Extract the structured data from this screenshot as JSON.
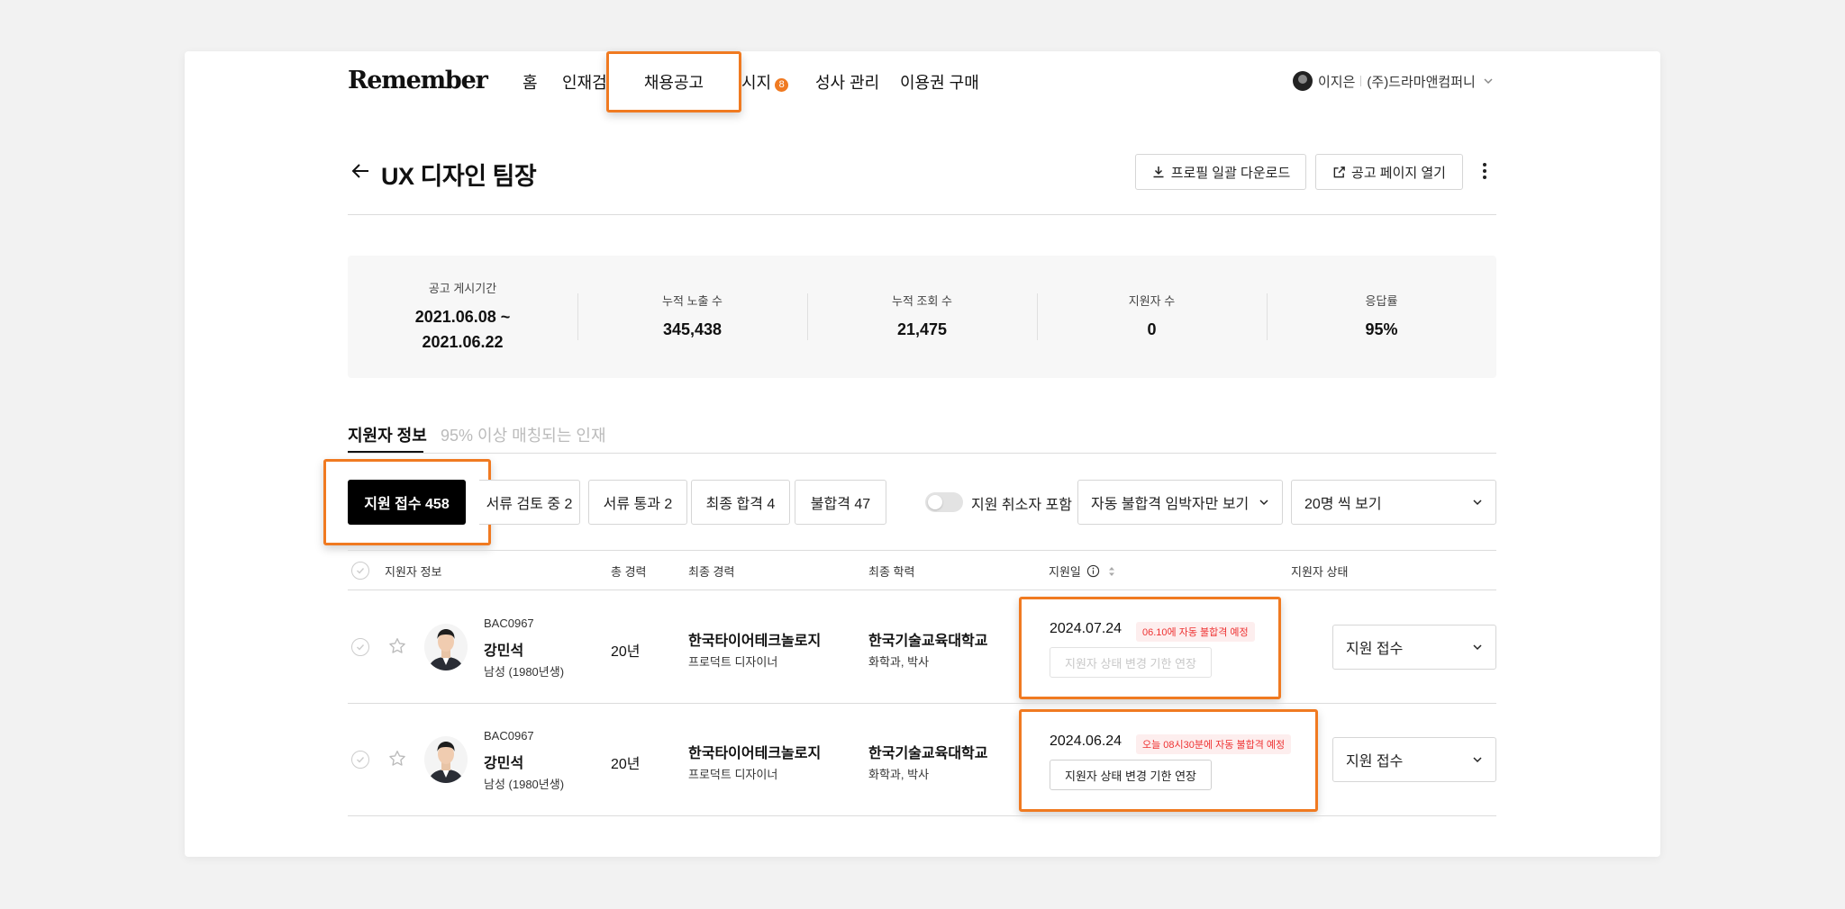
{
  "app": {
    "logo": "Remember"
  },
  "nav": {
    "items": [
      {
        "label": "홈"
      },
      {
        "label": "인재검"
      },
      {
        "label": "채용공고"
      },
      {
        "label": "시지"
      },
      {
        "label": "성사 관리"
      },
      {
        "label": "이용권 구매"
      }
    ],
    "message_badge": "8",
    "user_name": "이지은",
    "company": "(주)드라마앤컴퍼니"
  },
  "header": {
    "title": "UX 디자인 팀장",
    "download_label": "프로필 일괄 다운로드",
    "open_page_label": "공고 페이지 열기"
  },
  "stats": {
    "period": {
      "label": "공고 게시기간",
      "start": "2021.06.08 ~",
      "end": "2021.06.22"
    },
    "exposures": {
      "label": "누적 노출 수",
      "value": "345,438"
    },
    "views": {
      "label": "누적 조회 수",
      "value": "21,475"
    },
    "applicants": {
      "label": "지원자 수",
      "value": "0"
    },
    "response_rate": {
      "label": "응답률",
      "value": "95%"
    }
  },
  "tabs": [
    {
      "label": "지원자 정보",
      "active": true
    },
    {
      "label": "95% 이상 매칭되는 인재",
      "active": false
    }
  ],
  "filters": {
    "received": "지원 접수 458",
    "reviewing": "서류 검토 중 2",
    "passed_docs": "서류 통과 2",
    "final_pass": "최종 합격 4",
    "rejected": "불합격 47",
    "toggle_label": "지원 취소자 포함",
    "auto_reject_select": "자동 불합격 임박자만 보기",
    "page_size_select": "20명 씩 보기"
  },
  "table": {
    "headers": {
      "applicant_info": "지원자 정보",
      "total_experience": "총 경력",
      "last_career": "최종 경력",
      "last_education": "최종 학력",
      "applied_date": "지원일",
      "status": "지원자 상태"
    },
    "rows": [
      {
        "code": "BAC0967",
        "name": "강민석",
        "meta": "남성 (1980년생)",
        "years": "20년",
        "company": "한국타이어테크놀로지",
        "role": "프로덕트 디자이너",
        "school": "한국기술교육대학교",
        "major": "화학과, 박사",
        "date": "2024.07.24",
        "badge": "06.10에 자동 불합격 예정",
        "extend_label": "지원자 상태 변경 기한 연장",
        "extend_enabled": false,
        "status": "지원 접수"
      },
      {
        "code": "BAC0967",
        "name": "강민석",
        "meta": "남성 (1980년생)",
        "years": "20년",
        "company": "한국타이어테크놀로지",
        "role": "프로덕트 디자이너",
        "school": "한국기술교육대학교",
        "major": "화학과, 박사",
        "date": "2024.06.24",
        "badge": "오늘 08시30분에 자동 불합격 예정",
        "extend_label": "지원자 상태 변경 기한 연장",
        "extend_enabled": true,
        "status": "지원 접수"
      }
    ]
  },
  "colors": {
    "accent": "#f07a21",
    "warning_text": "#ee3333",
    "warning_bg": "#fdeeee",
    "primary_button": "#000000"
  }
}
